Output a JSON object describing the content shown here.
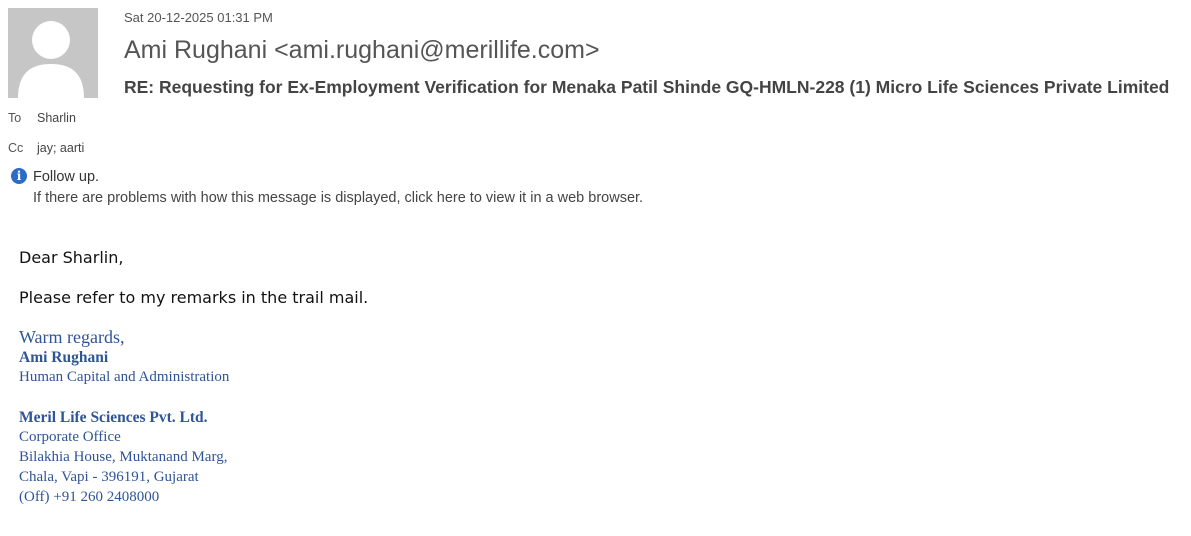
{
  "header": {
    "date": "Sat 20-12-2025 01:31 PM",
    "sender": "Ami Rughani <ami.rughani@merillife.com>",
    "subject": "RE: Requesting for Ex-Employment Verification for Menaka Patil Shinde GQ-HMLN-228 (1) Micro Life Sciences Private Limited"
  },
  "recipients": {
    "to_label": "To",
    "to_value": "Sharlin",
    "cc_label": "Cc",
    "cc_value": "jay; aarti"
  },
  "info_bar": {
    "icon": "info-icon",
    "follow_up": "Follow up.",
    "browser_notice": "If there are problems with how this message is displayed, click here to view it in a web browser."
  },
  "body": {
    "greeting": "Dear Sharlin,",
    "remarks": "Please refer to my remarks in the trail mail."
  },
  "signature": {
    "regards": "Warm regards,",
    "name": "Ami Rughani",
    "department": "Human Capital and Administration",
    "company": "Meril Life Sciences  Pvt. Ltd.",
    "office": "Corporate Office",
    "address_line1": "Bilakhia House, Muktanand Marg,",
    "address_line2": "Chala, Vapi - 396191, Gujarat",
    "phone": "(Off)  +91 260 2408000"
  }
}
